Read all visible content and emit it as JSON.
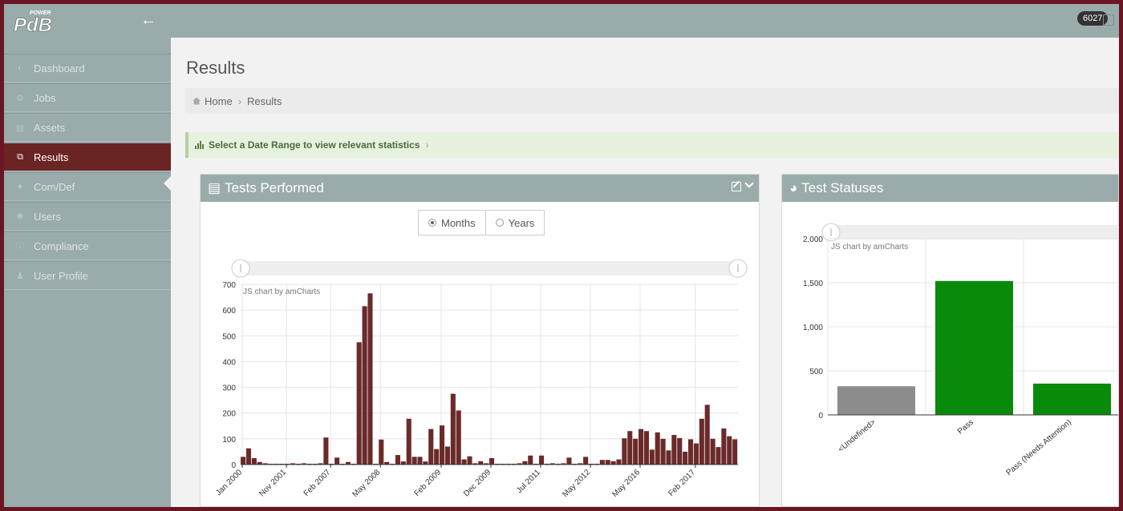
{
  "app": {
    "logo_text": "PdB",
    "logo_superscript": "POWER",
    "notification_count": "6027"
  },
  "sidebar": {
    "items": [
      {
        "label": "Dashboard",
        "icon": "dashboard-icon",
        "active": false
      },
      {
        "label": "Jobs",
        "icon": "cogs-icon",
        "active": false
      },
      {
        "label": "Assets",
        "icon": "assets-icon",
        "active": false
      },
      {
        "label": "Results",
        "icon": "results-icon",
        "active": true
      },
      {
        "label": "Com/Def",
        "icon": "comments-icon",
        "active": false
      },
      {
        "label": "Users",
        "icon": "users-icon",
        "active": false
      },
      {
        "label": "Compliance",
        "icon": "info-icon",
        "active": false
      },
      {
        "label": "User Profile",
        "icon": "user-icon",
        "active": false
      }
    ]
  },
  "page": {
    "title": "Results",
    "breadcrumb": [
      "Home",
      "Results"
    ],
    "date_range_prompt": "Select a Date Range to view relevant statistics"
  },
  "tests_panel": {
    "title": "Tests Performed",
    "toggle": {
      "months": "Months",
      "years": "Years",
      "selected": "Months"
    },
    "credit": "JS chart by amCharts"
  },
  "statuses_panel": {
    "title": "Test Statuses",
    "credit": "JS chart by amCharts"
  },
  "colors": {
    "accent": "#6a2424",
    "sidebar": "#9aabab",
    "tests_bar": "#6b2a2a",
    "status_undefined": "#8c8c8c",
    "status_pass": "#0a8a0a"
  },
  "chart_data": [
    {
      "type": "bar",
      "name": "tests-performed",
      "ylim": [
        0,
        700
      ],
      "yticks": [
        0,
        100,
        200,
        300,
        400,
        500,
        600,
        700
      ],
      "xtick_labels": [
        "Jan 2000",
        "Nov 2001",
        "Feb 2007",
        "May 2008",
        "Feb 2009",
        "Dec 2009",
        "Jul 2011",
        "May 2012",
        "May 2016",
        "Feb 2017"
      ],
      "xtick_bar_index": [
        0,
        8,
        16,
        25,
        36,
        45,
        54,
        63,
        72,
        82
      ],
      "values": [
        30,
        63,
        25,
        10,
        5,
        3,
        2,
        2,
        2,
        5,
        3,
        5,
        3,
        3,
        5,
        105,
        3,
        27,
        3,
        10,
        3,
        475,
        615,
        665,
        3,
        97,
        10,
        3,
        37,
        12,
        178,
        30,
        30,
        12,
        138,
        60,
        152,
        70,
        275,
        210,
        20,
        32,
        5,
        13,
        5,
        25,
        3,
        3,
        3,
        3,
        5,
        13,
        35,
        3,
        35,
        3,
        5,
        3,
        5,
        27,
        3,
        5,
        30,
        3,
        3,
        18,
        18,
        13,
        20,
        102,
        130,
        100,
        138,
        130,
        58,
        125,
        100,
        55,
        115,
        103,
        50,
        98,
        82,
        178,
        232,
        100,
        68,
        140,
        110,
        98
      ],
      "grid": true,
      "scrollbar": true
    },
    {
      "type": "bar",
      "name": "test-statuses",
      "categories": [
        "<Undefined>",
        "Pass",
        "Pass (Needs Attention)"
      ],
      "values": [
        325,
        1520,
        355
      ],
      "ylim": [
        0,
        2000
      ],
      "yticks": [
        0,
        500,
        1000,
        1500,
        2000
      ],
      "ytick_labels": [
        "0",
        "500",
        "1,000",
        "1,500",
        "2,000"
      ],
      "colors": [
        "#8c8c8c",
        "#0a8a0a",
        "#0a8a0a"
      ],
      "grid": true,
      "scrollbar": true
    }
  ]
}
